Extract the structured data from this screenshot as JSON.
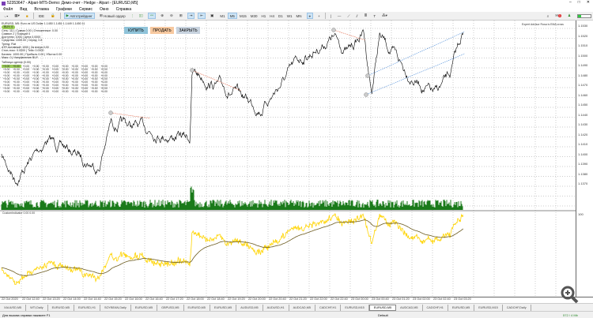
{
  "window": {
    "title": "52353647 - Alpari-MT5-Demo: Демо-счет - Hedge - Alpari - [EURUSD,M5]"
  },
  "menu": [
    "Файл",
    "Вид",
    "Вставка",
    "Графики",
    "Сервис",
    "Окно",
    "Справка"
  ],
  "toolbar": {
    "autotrading": "Автотрейдинг",
    "new_order": "Новый ордер",
    "timeframes": [
      "M1",
      "M5",
      "M15",
      "M30",
      "H1",
      "H4",
      "D1",
      "W1",
      "MN"
    ],
    "active_timeframe": "M5",
    "notification_count": "1"
  },
  "chart": {
    "symbol_line": "EURUSD, M5: Euro vs US Dollar 1.1450 1.1451 1.1449 1.1450 11",
    "status_bubble": "BUY: 0",
    "buy": "КУПИТЬ",
    "sell": "ПРОДАТЬ",
    "close": "ЗАКРЫТЬ",
    "expert": "Expert Advisor Rosa is EMA cross",
    "info_lines": [
      "Сеть: 111 | Сумма 0.00 | Отложенные: 0.00",
      "Символ 2 | Позиций 0",
      "Доступно: 1000 | Цена 0.0000",
      "Средства: 1000.00 | Спред: 0.8",
      "Тренд: Flat",
      "ATR Активный: 1000 | За вчера 0.00",
      "Стоп-лосс: 0.0000 | Тейк: 0.0000",
      "Баланс: 1000.00 | Прибыль 0.00 | Убыток 0.00",
      "Макс: 0 | Направление BUY"
    ],
    "grid_title": "Таблица сделок (0.00)",
    "grid_rows": [
      [
        "+0.00",
        "+0.00",
        "+0.00",
        "+0.00",
        "+0.00",
        "+0.00",
        "+0.00",
        "+0.00",
        "+0.00",
        "+0.00",
        "+0.00"
      ],
      [
        "+0.00",
        "+0.00",
        "+0.00",
        "+0.00",
        "+0.00",
        "+0.00",
        "+0.00",
        "+0.00",
        "+0.00",
        "+0.00",
        "+0.00"
      ],
      [
        "+0.00",
        "+0.00",
        "+0.00",
        "+0.00",
        "+0.00",
        "+0.00",
        "+0.00",
        "+0.00",
        "+0.00",
        "+0.00",
        "+0.00"
      ],
      [
        "+0.00",
        "+0.00",
        "+0.00",
        "+0.00",
        "+0.00",
        "+0.00",
        "+0.00",
        "+0.00",
        "+0.00",
        "+0.00",
        "+0.00"
      ],
      [
        "+0.00",
        "+0.00",
        "+0.00",
        "+0.00",
        "+0.00",
        "+0.00",
        "+0.00",
        "+0.00",
        "+0.00",
        "+0.00",
        "+0.00"
      ],
      [
        "+0.00",
        "+0.00",
        "+0.00",
        "+0.00",
        "+0.00",
        "+0.00",
        "+0.00",
        "+0.00",
        "+0.00",
        "+0.00",
        "+0.00"
      ],
      [
        "+0.00",
        "+0.00",
        "+0.00",
        "+0.00",
        "+0.00",
        "+0.00",
        "+0.00",
        "+0.00",
        "+0.00",
        "+0.00",
        "+0.00"
      ],
      [
        "+0.00",
        "+0.00",
        "+0.00",
        "+0.00",
        "+0.00",
        "+0.00",
        "+0.00",
        "+0.00",
        "+0.00",
        "+0.00",
        "+0.00"
      ],
      [
        "+0.00",
        "+0.00",
        "+0.00",
        "+0.00",
        "+0.00",
        "+0.00",
        "+0.00",
        "+0.00",
        "+0.00",
        "+0.00",
        "+0.00"
      ]
    ],
    "indicator_label": "CustomIndicator 0.00 0.00",
    "price_labels": [
      "1.1530",
      "1.1520",
      "1.1510",
      "1.1500",
      "1.1490",
      "1.1480",
      "1.1470",
      "1.1460",
      "1.1450",
      "1.1440",
      "1.1430",
      "1.1420",
      "1.1410",
      "1.1400",
      "1.1390",
      "1.1380",
      "1.1370"
    ],
    "indicator_axis": "100",
    "time_labels": [
      "22 Oct 2020",
      "22 Oct 12:40",
      "22 Oct 13:20",
      "22 Oct 14:00",
      "22 Oct 14:40",
      "22 Oct 15:20",
      "22 Oct 16:00",
      "22 Oct 16:40",
      "22 Oct 17:20",
      "22 Oct 18:00",
      "22 Oct 18:40",
      "22 Oct 19:20",
      "22 Oct 20:00",
      "22 Oct 20:40",
      "22 Oct 21:20",
      "22 Oct 22:00",
      "22 Oct 22:40",
      "23 Oct 00:00",
      "23 Oct 00:40",
      "23 Oct 01:20",
      "23 Oct 02:00",
      "23 Oct 02:40",
      "23 Oct 03:20"
    ]
  },
  "tabs": [
    "XAUUSD,M5",
    "WTI,Daily",
    "EURUSD,M5",
    "EURUSD,H1",
    "SOYBEAN,Daily",
    "EURUSD,M5",
    "GBPUSD,M5",
    "EURUSD,M5",
    "EURUSD,M5",
    "AUDUSD,M5",
    "AUDUSD,H1",
    "AUDCAD,M5",
    "CADCHF,H1",
    "EURUSD,M15",
    "EURUSD,M5",
    "AUDCAD,M5",
    "CADCHF,H1",
    "EURUSD,M5",
    "EURUSD,M15",
    "CADCHF,Daily"
  ],
  "active_tab": 14,
  "status": {
    "help": "Для вызова справки нажмите F1",
    "profile": "Default",
    "connection": "572 / 4 Mb"
  },
  "colors": {
    "price": "#000000",
    "volume": "#1a7a1a",
    "indicator_fast": "#ffd400",
    "indicator_slow": "#6b5a1e",
    "highlight": "#9ccc5a",
    "buy": "#8fc3d9",
    "sell": "#f7c9a0",
    "close": "#c8d3df"
  }
}
